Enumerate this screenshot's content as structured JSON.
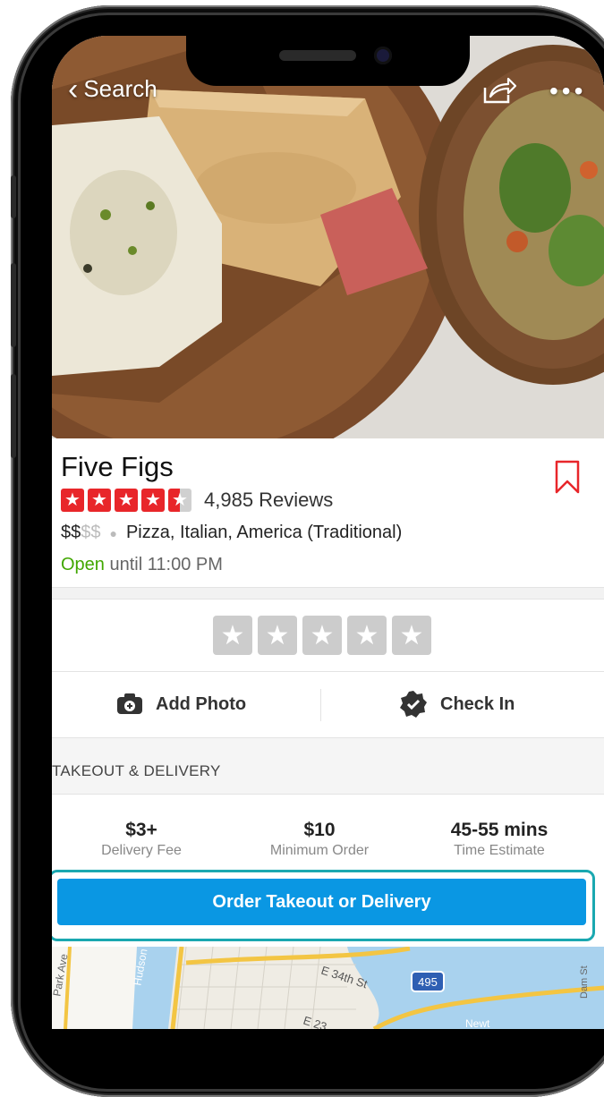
{
  "nav": {
    "back_label": "Search"
  },
  "business": {
    "name": "Five Figs",
    "reviews": "4,985 Reviews",
    "price_active": "$$",
    "price_inactive": "$$",
    "categories": "Pizza, Italian, America (Traditional)",
    "open_status": "Open",
    "hours": "until 11:00 PM",
    "rating": 4.5
  },
  "actions": {
    "add_photo": "Add Photo",
    "check_in": "Check In"
  },
  "takeout": {
    "title": "TAKEOUT & DELIVERY",
    "stats": [
      {
        "value": "$3+",
        "label": "Delivery Fee"
      },
      {
        "value": "$10",
        "label": "Minimum Order"
      },
      {
        "value": "45-55 mins",
        "label": "Time Estimate"
      }
    ],
    "order_button": "Order Takeout or Delivery"
  },
  "map": {
    "labels": [
      "Park Ave",
      "Hudson",
      "E 34th St",
      "495",
      "E 23",
      "Newt",
      "Dam St"
    ]
  },
  "colors": {
    "accent_red": "#e8262a",
    "open_green": "#41a700",
    "button_blue": "#0a97e3",
    "highlight_teal": "#1aa8b0"
  }
}
